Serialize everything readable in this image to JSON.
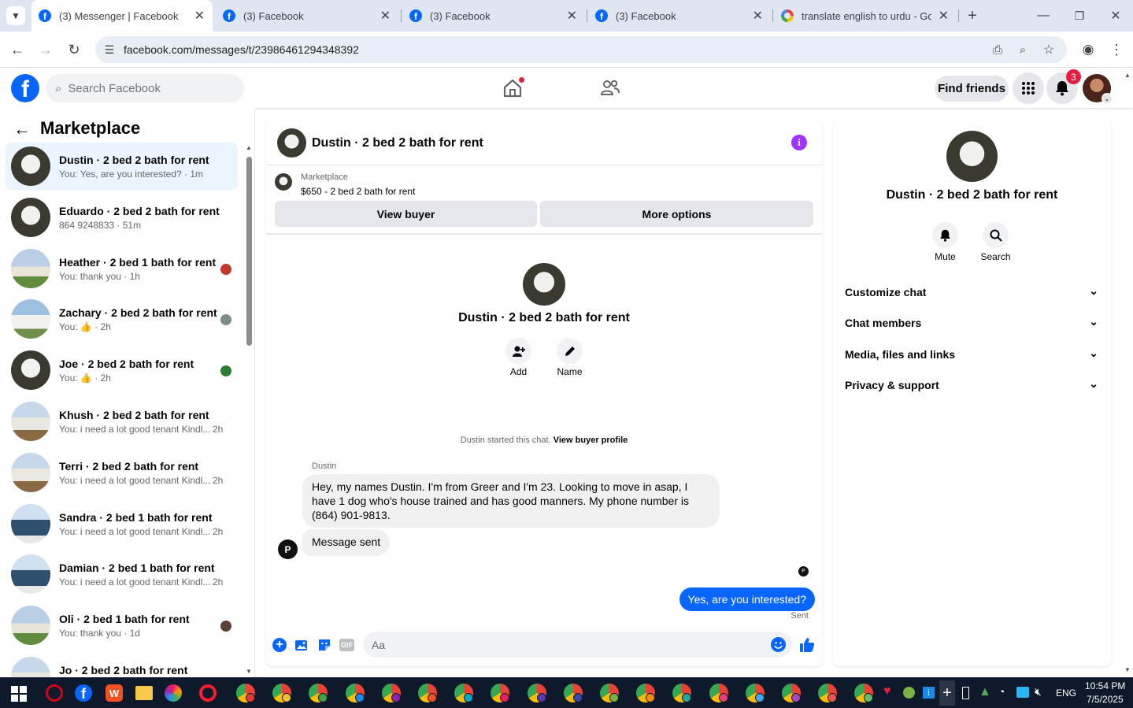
{
  "browser": {
    "tabs": [
      {
        "title": "(3) Messenger | Facebook",
        "icon": "facebook-icon",
        "active": true
      },
      {
        "title": "(3) Facebook",
        "icon": "facebook-icon",
        "active": false
      },
      {
        "title": "(3) Facebook",
        "icon": "facebook-icon",
        "active": false
      },
      {
        "title": "(3) Facebook",
        "icon": "facebook-icon",
        "active": false
      },
      {
        "title": "translate english to urdu - Goo",
        "icon": "google-icon",
        "active": false
      }
    ],
    "url": "facebook.com/messages/t/23986461294348392"
  },
  "fb_header": {
    "search_placeholder": "Search Facebook",
    "find_friends": "Find friends",
    "notification_count": "3"
  },
  "left": {
    "title": "Marketplace",
    "conversations": [
      {
        "name": "Dustin · 2 bed 2 bath for rent",
        "preview": "You: Yes, are you interested? · 1m",
        "time": "",
        "selected": true
      },
      {
        "name": "Eduardo · 2 bed 2 bath for rent",
        "preview": "864 9248833 · 51m",
        "time": "",
        "selected": false
      },
      {
        "name": "Heather · 2 bed 1 bath for rent",
        "preview": "You: thank you · 1h",
        "time": "",
        "selected": false
      },
      {
        "name": "Zachary · 2 bed 2 bath for rent",
        "preview": "You: 👍 · 2h",
        "time": "",
        "selected": false
      },
      {
        "name": "Joe · 2 bed 2 bath for rent",
        "preview": "You: 👍 · 2h",
        "time": "",
        "selected": false
      },
      {
        "name": "Khush · 2 bed 2 bath for rent",
        "preview": "You: i need a lot good tenant Kindl...",
        "time": "2h",
        "selected": false
      },
      {
        "name": "Terri · 2 bed 2 bath for rent",
        "preview": "You: i need a lot good tenant Kindl...",
        "time": "2h",
        "selected": false
      },
      {
        "name": "Sandra · 2 bed 1 bath for rent",
        "preview": "You: i need a lot good tenant Kindl...",
        "time": "2h",
        "selected": false
      },
      {
        "name": "Damian · 2 bed 1 bath for rent",
        "preview": "You: i need a lot good tenant Kindl...",
        "time": "2h",
        "selected": false
      },
      {
        "name": "Oli · 2 bed 1 bath for rent",
        "preview": "You: thank you · 1d",
        "time": "",
        "selected": false
      },
      {
        "name": "Jo · 2 bed 2 bath for rent",
        "preview": "",
        "time": "",
        "selected": false
      }
    ]
  },
  "chat": {
    "header_title": "Dustin · 2 bed 2 bath for rent",
    "listing_source": "Marketplace",
    "listing_title": "$650 - 2 bed 2 bath for rent",
    "view_buyer": "View buyer",
    "more_options": "More options",
    "profile_name": "Dustin · 2 bed 2 bath for rent",
    "add_label": "Add",
    "name_label": "Name",
    "started_text": "Dustin started this chat.",
    "view_buyer_profile": "View buyer profile",
    "sender_name": "Dustin",
    "incoming_message": "Hey, my names Dustin. I'm from Greer and I'm 23. Looking to move in asap, I have 1 dog who's house trained and has good manners. My phone number is (864) 901-9813.",
    "incoming_message_2": "Message sent",
    "outgoing_message": "Yes, are you interested?",
    "status": "Sent",
    "composer_placeholder": "Aa",
    "gif_label": "GIF"
  },
  "right": {
    "name": "Dustin · 2 bed 2 bath for rent",
    "mute": "Mute",
    "search": "Search",
    "sections": [
      "Customize chat",
      "Chat members",
      "Media, files and links",
      "Privacy & support"
    ]
  },
  "taskbar": {
    "lang": "ENG",
    "time": "10:54 PM",
    "date": "7/5/2025"
  },
  "colors": {
    "accent_blue": "#0866ff",
    "messenger_purple": "#a033ff",
    "selected_bg": "#ebf5ff"
  }
}
